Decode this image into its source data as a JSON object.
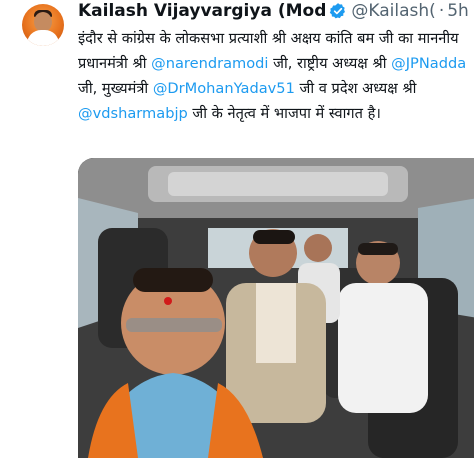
{
  "author": {
    "name": "Kailash Vijayvargiya (Mod",
    "handle": "@Kailash(",
    "separator": "·",
    "time": "5h",
    "avatar_icon": "profile-avatar"
  },
  "tweet": {
    "t1": "इंदौर से कांग्रेस के लोकसभा प्रत्याशी श्री अक्षय कांति बम जी का माननीय प्रधानमंत्री श्री ",
    "m1": "@narendramodi",
    "t2": " जी, राष्ट्रीय अध्यक्ष श्री ",
    "m2": "@JPNadda",
    "t3": " जी, मुख्यमंत्री ",
    "m3": "@DrMohanYadav51",
    "t4": " जी व प्रदेश अध्यक्ष श्री ",
    "m4": "@vdsharmabjp",
    "t5": " जी के नेतृत्व में भाजपा में स्वागत है।"
  },
  "colors": {
    "link": "#1d9bf0",
    "verified": "#1d9bf0",
    "avatar_bg": "#e8731e"
  },
  "media": {
    "type": "photo",
    "icon": "car-selfie-photo"
  }
}
